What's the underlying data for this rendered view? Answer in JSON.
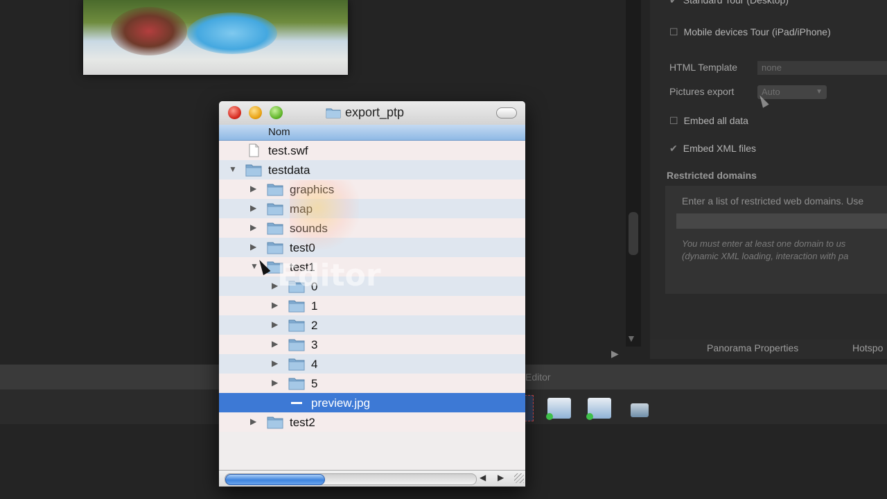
{
  "window": {
    "title": "export_ptp",
    "column_header": "Nom"
  },
  "tree": [
    {
      "name": "test.swf",
      "type": "file",
      "indent": 0,
      "expanded": null,
      "selected": false
    },
    {
      "name": "testdata",
      "type": "folder",
      "indent": 0,
      "expanded": true,
      "selected": false
    },
    {
      "name": "graphics",
      "type": "folder",
      "indent": 1,
      "expanded": false,
      "selected": false
    },
    {
      "name": "map",
      "type": "folder",
      "indent": 1,
      "expanded": false,
      "selected": false
    },
    {
      "name": "sounds",
      "type": "folder",
      "indent": 1,
      "expanded": false,
      "selected": false
    },
    {
      "name": "test0",
      "type": "folder",
      "indent": 1,
      "expanded": false,
      "selected": false
    },
    {
      "name": "test1",
      "type": "folder",
      "indent": 1,
      "expanded": true,
      "selected": false
    },
    {
      "name": "0",
      "type": "folder",
      "indent": 2,
      "expanded": false,
      "selected": false
    },
    {
      "name": "1",
      "type": "folder",
      "indent": 2,
      "expanded": false,
      "selected": false
    },
    {
      "name": "2",
      "type": "folder",
      "indent": 2,
      "expanded": false,
      "selected": false
    },
    {
      "name": "3",
      "type": "folder",
      "indent": 2,
      "expanded": false,
      "selected": false
    },
    {
      "name": "4",
      "type": "folder",
      "indent": 2,
      "expanded": false,
      "selected": false
    },
    {
      "name": "5",
      "type": "folder",
      "indent": 2,
      "expanded": false,
      "selected": false
    },
    {
      "name": "preview.jpg",
      "type": "file",
      "indent": 2,
      "expanded": null,
      "selected": true
    },
    {
      "name": "test2",
      "type": "folder",
      "indent": 1,
      "expanded": false,
      "selected": false
    }
  ],
  "background_app": {
    "panel": {
      "standard_tour": "Standard Tour (Desktop)",
      "mobile_tour": "Mobile devices Tour (iPad/iPhone)",
      "html_template_label": "HTML Template",
      "html_template_value": "none",
      "pictures_export_label": "Pictures export",
      "pictures_export_value": "Auto",
      "embed_all_data": "Embed all data",
      "embed_xml_files": "Embed XML files",
      "restricted_domains_title": "Restricted domains",
      "restricted_domains_hint": "Enter a list of restricted web domains. Use",
      "restricted_domains_note": "You must enter at least one domain to us",
      "restricted_domains_note2": "(dynamic XML loading, interaction with pa"
    },
    "tabs": [
      "Panorama Properties",
      "Hotspo"
    ],
    "bar_label": "Editor",
    "watermark": "Editor"
  },
  "colors": {
    "selection": "#3d79d5",
    "header_blue": "#8fb9e5"
  }
}
